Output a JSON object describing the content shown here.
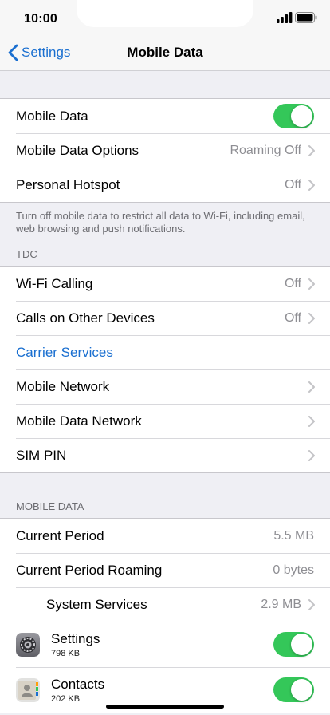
{
  "status": {
    "time": "10:00"
  },
  "nav": {
    "back_label": "Settings",
    "title": "Mobile Data"
  },
  "group1": {
    "mobile_data_label": "Mobile Data",
    "mobile_data_on": true,
    "options_label": "Mobile Data Options",
    "options_value": "Roaming Off",
    "hotspot_label": "Personal Hotspot",
    "hotspot_value": "Off"
  },
  "group1_footer": "Turn off mobile data to restrict all data to Wi-Fi, including email, web browsing and push notifications.",
  "carrier_header": "TDC",
  "group2": {
    "wifi_calling_label": "Wi-Fi Calling",
    "wifi_calling_value": "Off",
    "calls_other_label": "Calls on Other Devices",
    "calls_other_value": "Off",
    "carrier_services_label": "Carrier Services",
    "mobile_network_label": "Mobile Network",
    "mobile_data_network_label": "Mobile Data Network",
    "sim_pin_label": "SIM PIN"
  },
  "usage_header": "MOBILE DATA",
  "group3": {
    "current_period_label": "Current Period",
    "current_period_value": "5.5 MB",
    "current_roaming_label": "Current Period Roaming",
    "current_roaming_value": "0 bytes",
    "system_services_label": "System Services",
    "system_services_value": "2.9 MB",
    "apps": [
      {
        "name": "Settings",
        "size": "798 KB",
        "icon": "settings-gear-icon",
        "enabled": true
      },
      {
        "name": "Contacts",
        "size": "202 KB",
        "icon": "contacts-icon",
        "enabled": true
      }
    ]
  },
  "colors": {
    "accent": "#1a6fd0",
    "toggle_on": "#34c759",
    "background": "#efeff4"
  }
}
